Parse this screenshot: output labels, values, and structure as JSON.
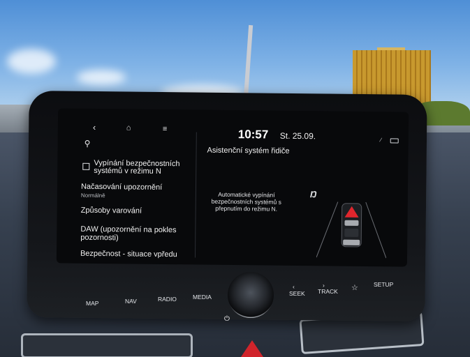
{
  "screen": {
    "time": "10:57",
    "date": "St. 25.09.",
    "title": "Asistenční systém řidiče",
    "menu": {
      "item1_line1": "Vypínání bezpečnostních",
      "item1_line2": "systémů v režimu N",
      "item2": "Načasování upozornění",
      "item2_sub": "Normálně",
      "item3": "Způsoby varování",
      "item4_line1": "DAW (upozornění na pokles",
      "item4_line2": "pozornosti)",
      "item5": "Bezpečnost - situace vpředu"
    },
    "description": {
      "line1": "Automatické vypínání",
      "line2": "bezpečnostních systémů s",
      "line3": "přepnutím do režimu N."
    }
  },
  "buttons": {
    "map": "MAP",
    "nav": "NAV",
    "radio": "RADIO",
    "media": "MEDIA",
    "seek": "SEEK",
    "track": "TRACK",
    "setup": "SETUP"
  },
  "icons": {
    "back": "back-icon",
    "home": "home-icon",
    "menu": "menu-icon",
    "search": "search-icon",
    "favorite": "star-icon",
    "power": "power-icon"
  },
  "colors": {
    "screen_bg": "#08090b",
    "warning_red": "#e0262d"
  }
}
